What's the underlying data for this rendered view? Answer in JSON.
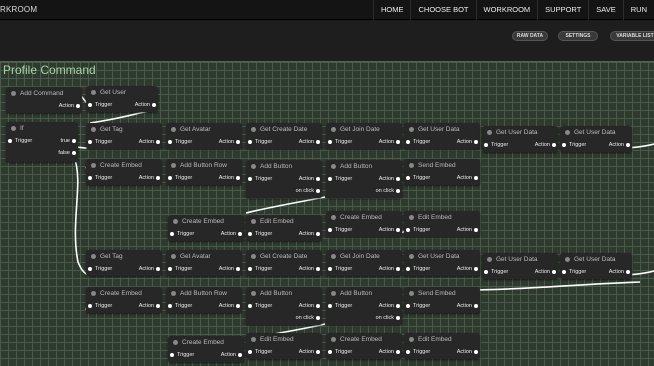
{
  "app": {
    "brand": "RKROOM",
    "nav": [
      "HOME",
      "CHOOSE BOT",
      "WORKROOM",
      "SUPPORT",
      "SAVE",
      "RUN"
    ]
  },
  "toolbar": {
    "raw_data": "RAW DATA",
    "settings": "SETTINGS",
    "variable_list": "VARIABLE LIST"
  },
  "canvas": {
    "title": "Profile Command"
  },
  "labels": {
    "trigger": "Trigger",
    "action": "Action",
    "on_click": "on click",
    "true": "true",
    "false": "false"
  },
  "nodes": {
    "add_command": "Add Command",
    "get_user": "Get User",
    "if": "If",
    "r1": [
      "Get Tag",
      "Get Avatar",
      "Get Create Date",
      "Get Join Date",
      "Get User Data",
      "Get User Data",
      "Get User Data"
    ],
    "r2": [
      "Create Embed",
      "Add Button Row",
      "Add Button",
      "Add Button",
      "Send Embed"
    ],
    "r3": [
      "Create Embed",
      "Edit Embed",
      "Create Embed",
      "Edit Embed"
    ],
    "r4": [
      "Get Tag",
      "Get Avatar",
      "Get Create Date",
      "Get Join Date",
      "Get User Data",
      "Get User Data",
      "Get User Data"
    ],
    "r5": [
      "Create Embed",
      "Add Button Row",
      "Add Button",
      "Add Button",
      "Send Embed"
    ],
    "r6": [
      "Create Embed",
      "Edit Embed",
      "Create Embed",
      "Edit Embed"
    ]
  }
}
